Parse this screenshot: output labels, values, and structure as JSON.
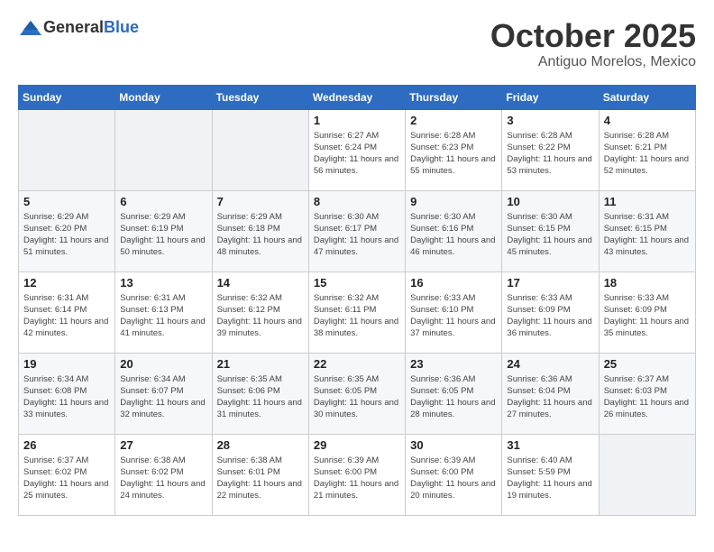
{
  "header": {
    "logo_general": "General",
    "logo_blue": "Blue",
    "month": "October 2025",
    "location": "Antiguo Morelos, Mexico"
  },
  "weekdays": [
    "Sunday",
    "Monday",
    "Tuesday",
    "Wednesday",
    "Thursday",
    "Friday",
    "Saturday"
  ],
  "weeks": [
    [
      {
        "day": "",
        "info": ""
      },
      {
        "day": "",
        "info": ""
      },
      {
        "day": "",
        "info": ""
      },
      {
        "day": "1",
        "info": "Sunrise: 6:27 AM\nSunset: 6:24 PM\nDaylight: 11 hours and 56 minutes."
      },
      {
        "day": "2",
        "info": "Sunrise: 6:28 AM\nSunset: 6:23 PM\nDaylight: 11 hours and 55 minutes."
      },
      {
        "day": "3",
        "info": "Sunrise: 6:28 AM\nSunset: 6:22 PM\nDaylight: 11 hours and 53 minutes."
      },
      {
        "day": "4",
        "info": "Sunrise: 6:28 AM\nSunset: 6:21 PM\nDaylight: 11 hours and 52 minutes."
      }
    ],
    [
      {
        "day": "5",
        "info": "Sunrise: 6:29 AM\nSunset: 6:20 PM\nDaylight: 11 hours and 51 minutes."
      },
      {
        "day": "6",
        "info": "Sunrise: 6:29 AM\nSunset: 6:19 PM\nDaylight: 11 hours and 50 minutes."
      },
      {
        "day": "7",
        "info": "Sunrise: 6:29 AM\nSunset: 6:18 PM\nDaylight: 11 hours and 48 minutes."
      },
      {
        "day": "8",
        "info": "Sunrise: 6:30 AM\nSunset: 6:17 PM\nDaylight: 11 hours and 47 minutes."
      },
      {
        "day": "9",
        "info": "Sunrise: 6:30 AM\nSunset: 6:16 PM\nDaylight: 11 hours and 46 minutes."
      },
      {
        "day": "10",
        "info": "Sunrise: 6:30 AM\nSunset: 6:15 PM\nDaylight: 11 hours and 45 minutes."
      },
      {
        "day": "11",
        "info": "Sunrise: 6:31 AM\nSunset: 6:15 PM\nDaylight: 11 hours and 43 minutes."
      }
    ],
    [
      {
        "day": "12",
        "info": "Sunrise: 6:31 AM\nSunset: 6:14 PM\nDaylight: 11 hours and 42 minutes."
      },
      {
        "day": "13",
        "info": "Sunrise: 6:31 AM\nSunset: 6:13 PM\nDaylight: 11 hours and 41 minutes."
      },
      {
        "day": "14",
        "info": "Sunrise: 6:32 AM\nSunset: 6:12 PM\nDaylight: 11 hours and 39 minutes."
      },
      {
        "day": "15",
        "info": "Sunrise: 6:32 AM\nSunset: 6:11 PM\nDaylight: 11 hours and 38 minutes."
      },
      {
        "day": "16",
        "info": "Sunrise: 6:33 AM\nSunset: 6:10 PM\nDaylight: 11 hours and 37 minutes."
      },
      {
        "day": "17",
        "info": "Sunrise: 6:33 AM\nSunset: 6:09 PM\nDaylight: 11 hours and 36 minutes."
      },
      {
        "day": "18",
        "info": "Sunrise: 6:33 AM\nSunset: 6:09 PM\nDaylight: 11 hours and 35 minutes."
      }
    ],
    [
      {
        "day": "19",
        "info": "Sunrise: 6:34 AM\nSunset: 6:08 PM\nDaylight: 11 hours and 33 minutes."
      },
      {
        "day": "20",
        "info": "Sunrise: 6:34 AM\nSunset: 6:07 PM\nDaylight: 11 hours and 32 minutes."
      },
      {
        "day": "21",
        "info": "Sunrise: 6:35 AM\nSunset: 6:06 PM\nDaylight: 11 hours and 31 minutes."
      },
      {
        "day": "22",
        "info": "Sunrise: 6:35 AM\nSunset: 6:05 PM\nDaylight: 11 hours and 30 minutes."
      },
      {
        "day": "23",
        "info": "Sunrise: 6:36 AM\nSunset: 6:05 PM\nDaylight: 11 hours and 28 minutes."
      },
      {
        "day": "24",
        "info": "Sunrise: 6:36 AM\nSunset: 6:04 PM\nDaylight: 11 hours and 27 minutes."
      },
      {
        "day": "25",
        "info": "Sunrise: 6:37 AM\nSunset: 6:03 PM\nDaylight: 11 hours and 26 minutes."
      }
    ],
    [
      {
        "day": "26",
        "info": "Sunrise: 6:37 AM\nSunset: 6:02 PM\nDaylight: 11 hours and 25 minutes."
      },
      {
        "day": "27",
        "info": "Sunrise: 6:38 AM\nSunset: 6:02 PM\nDaylight: 11 hours and 24 minutes."
      },
      {
        "day": "28",
        "info": "Sunrise: 6:38 AM\nSunset: 6:01 PM\nDaylight: 11 hours and 22 minutes."
      },
      {
        "day": "29",
        "info": "Sunrise: 6:39 AM\nSunset: 6:00 PM\nDaylight: 11 hours and 21 minutes."
      },
      {
        "day": "30",
        "info": "Sunrise: 6:39 AM\nSunset: 6:00 PM\nDaylight: 11 hours and 20 minutes."
      },
      {
        "day": "31",
        "info": "Sunrise: 6:40 AM\nSunset: 5:59 PM\nDaylight: 11 hours and 19 minutes."
      },
      {
        "day": "",
        "info": ""
      }
    ]
  ]
}
